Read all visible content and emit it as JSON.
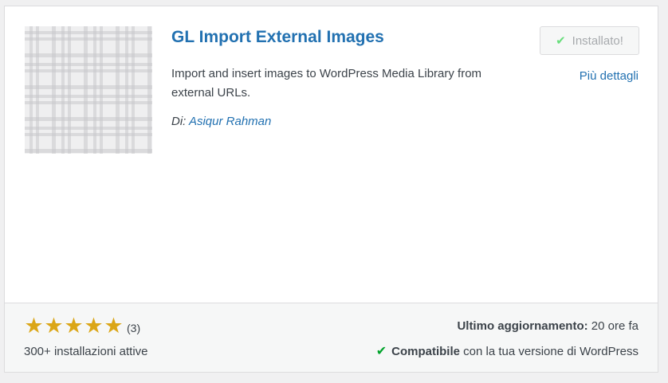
{
  "plugin": {
    "title": "GL Import External Images",
    "description": "Import and insert images to WordPress Media Library from external URLs.",
    "author_prefix": "Di:",
    "author_name": "Asiqur Rahman",
    "thumbnail_icon": "plaid-pattern-placeholder"
  },
  "actions": {
    "installed_label": "Installato!",
    "more_details_label": "Più dettagli"
  },
  "footer": {
    "rating_stars": 5,
    "rating_count": "(3)",
    "active_installs": "300+ installazioni attive",
    "last_updated_label": "Ultimo aggiornamento:",
    "last_updated_value": "20 ore fa",
    "compat_strong": "Compatibile",
    "compat_rest": "con la tua versione di WordPress"
  },
  "colors": {
    "link": "#2271b1",
    "star": "#dba617",
    "check_installed": "#68de7c",
    "check_compat": "#00a32a"
  }
}
